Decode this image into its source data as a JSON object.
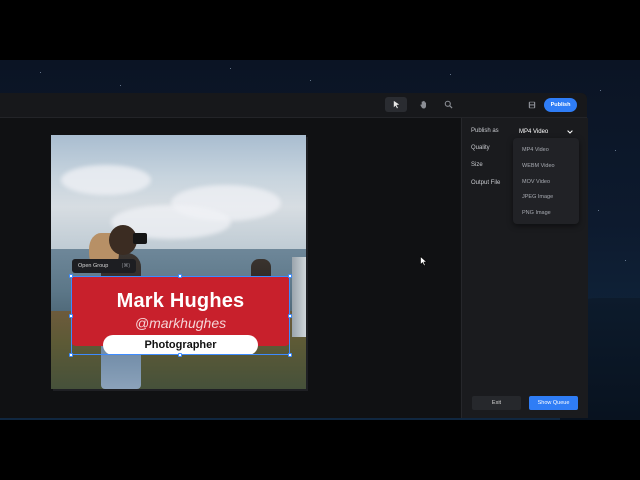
{
  "toolbar": {
    "tools": [
      {
        "icon": "pointer-icon",
        "active": true
      },
      {
        "icon": "hand-icon",
        "active": false
      },
      {
        "icon": "zoom-icon",
        "active": false
      }
    ],
    "save_icon": "save-icon",
    "publish_label": "Publish"
  },
  "canvas": {
    "context_menu": {
      "label": "Open Group",
      "shortcut": "(⌘)"
    },
    "lower_third": {
      "name": "Mark Hughes",
      "handle": "@markhughes",
      "role": "Photographer",
      "card_color": "#c8202c"
    }
  },
  "publish_panel": {
    "publish_as_label": "Publish as",
    "publish_as_value": "MP4 Video",
    "quality_label": "Quality",
    "size_label": "Size",
    "output_file_label": "Output File",
    "format_options": [
      "MP4 Video",
      "WEBM Video",
      "MOV Video",
      "JPEG Image",
      "PNG Image"
    ],
    "exit_label": "Exit",
    "show_queue_label": "Show Queue"
  },
  "colors": {
    "accent": "#2f7df6",
    "selection": "#3d8bff"
  }
}
